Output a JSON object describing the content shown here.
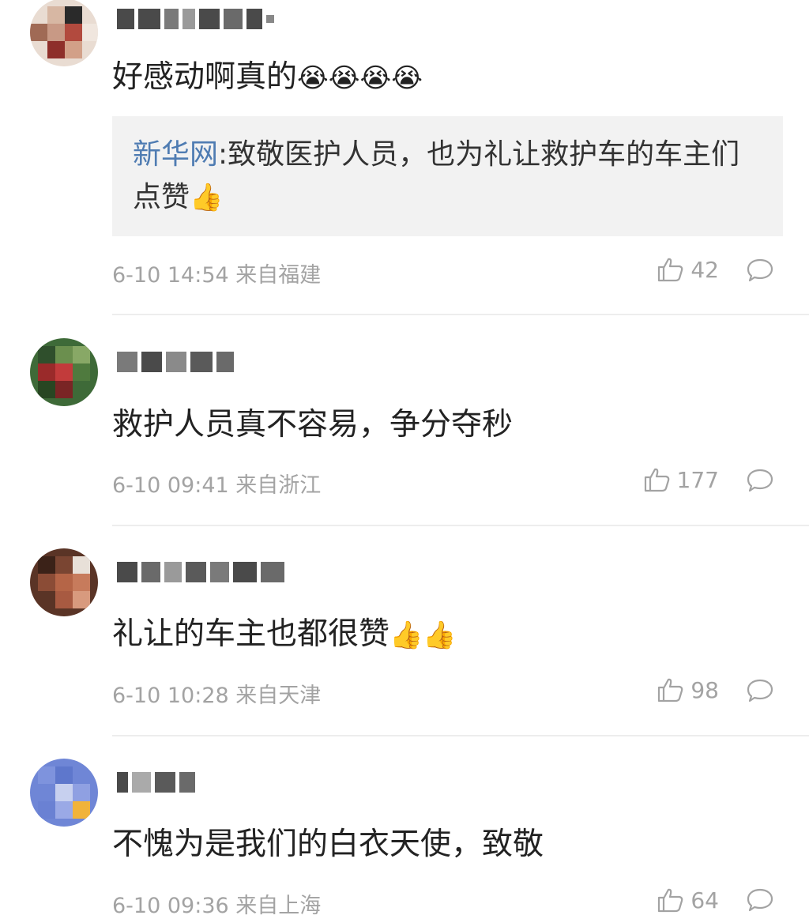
{
  "colors": {
    "text": "#222222",
    "meta": "#a3a3a3",
    "quote_source": "#4f7cb2",
    "quote_bg": "#f2f2f2",
    "divider": "#ededed"
  },
  "comments": [
    {
      "text": "好感动啊真的",
      "emojis": "😭😭😭😭",
      "quote": {
        "source": "新华网",
        "separator": ":",
        "text": "致敬医护人员，也为礼让救护车的车主们点赞",
        "emoji": "👍"
      },
      "timestamp": "6-10 14:54",
      "location": "来自福建",
      "likes": "42",
      "like_icon": "thumbs-up-icon",
      "reply_icon": "comment-bubble-icon"
    },
    {
      "text": "救护人员真不容易，争分夺秒",
      "timestamp": "6-10 09:41",
      "location": "来自浙江",
      "likes": "177",
      "like_icon": "thumbs-up-icon",
      "reply_icon": "comment-bubble-icon"
    },
    {
      "text": "礼让的车主也都很赞",
      "emojis": "👍👍",
      "timestamp": "6-10 10:28",
      "location": "来自天津",
      "likes": "98",
      "like_icon": "thumbs-up-icon",
      "reply_icon": "comment-bubble-icon"
    },
    {
      "text": "不愧为是我们的白衣天使，致敬",
      "timestamp": "6-10 09:36",
      "location": "来自上海",
      "likes": "64",
      "like_icon": "thumbs-up-icon",
      "reply_icon": "comment-bubble-icon"
    }
  ]
}
